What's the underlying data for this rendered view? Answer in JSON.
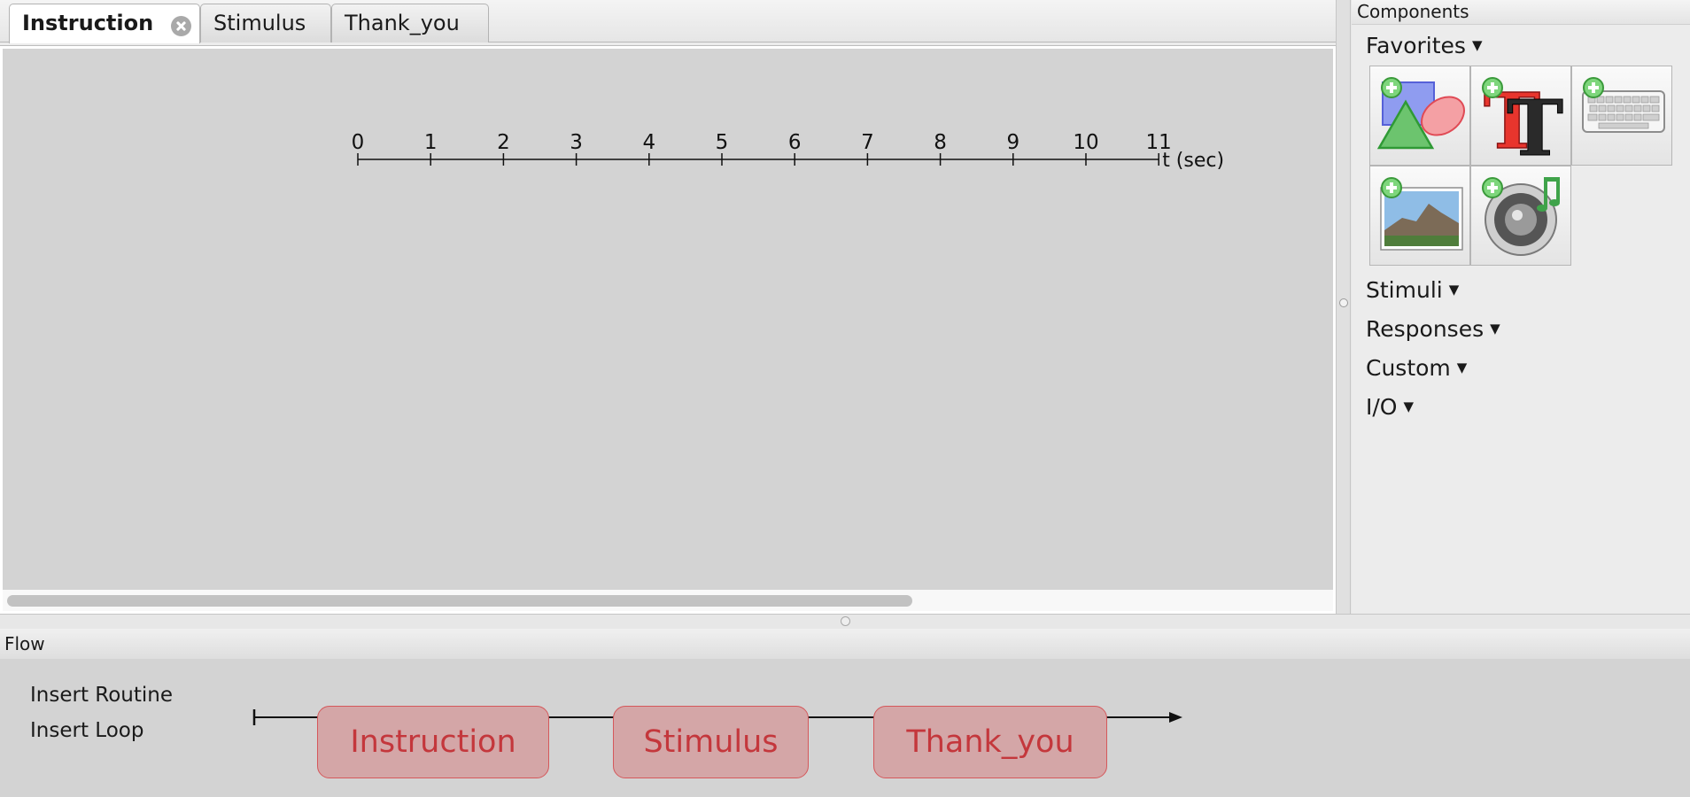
{
  "tabs": [
    {
      "label": "Instruction",
      "active": true,
      "closable": true
    },
    {
      "label": "Stimulus",
      "active": false
    },
    {
      "label": "Thank_you",
      "active": false
    }
  ],
  "timeline": {
    "ticks": [
      "0",
      "1",
      "2",
      "3",
      "4",
      "5",
      "6",
      "7",
      "8",
      "9",
      "10",
      "11"
    ],
    "axis_label": "t (sec)"
  },
  "components": {
    "title": "Components",
    "categories": [
      {
        "label": "Favorites",
        "arrow": "▼"
      },
      {
        "label": "Stimuli",
        "arrow": "▼"
      },
      {
        "label": "Responses",
        "arrow": "▼"
      },
      {
        "label": "Custom",
        "arrow": "▼"
      },
      {
        "label": "I/O",
        "arrow": "▼"
      }
    ],
    "favorites": [
      {
        "icon": "polygon-shapes-icon"
      },
      {
        "icon": "text-icon"
      },
      {
        "icon": "keyboard-icon"
      },
      {
        "icon": "image-icon"
      },
      {
        "icon": "sound-icon"
      }
    ]
  },
  "flow": {
    "title": "Flow",
    "insert_routine": "Insert Routine",
    "insert_loop": "Insert Loop",
    "routines": [
      "Instruction",
      "Stimulus",
      "Thank_you"
    ]
  },
  "colors": {
    "routine_fill": "#d4a6a7",
    "routine_text": "#c4373c",
    "canvas_bg": "#d3d3d3"
  }
}
